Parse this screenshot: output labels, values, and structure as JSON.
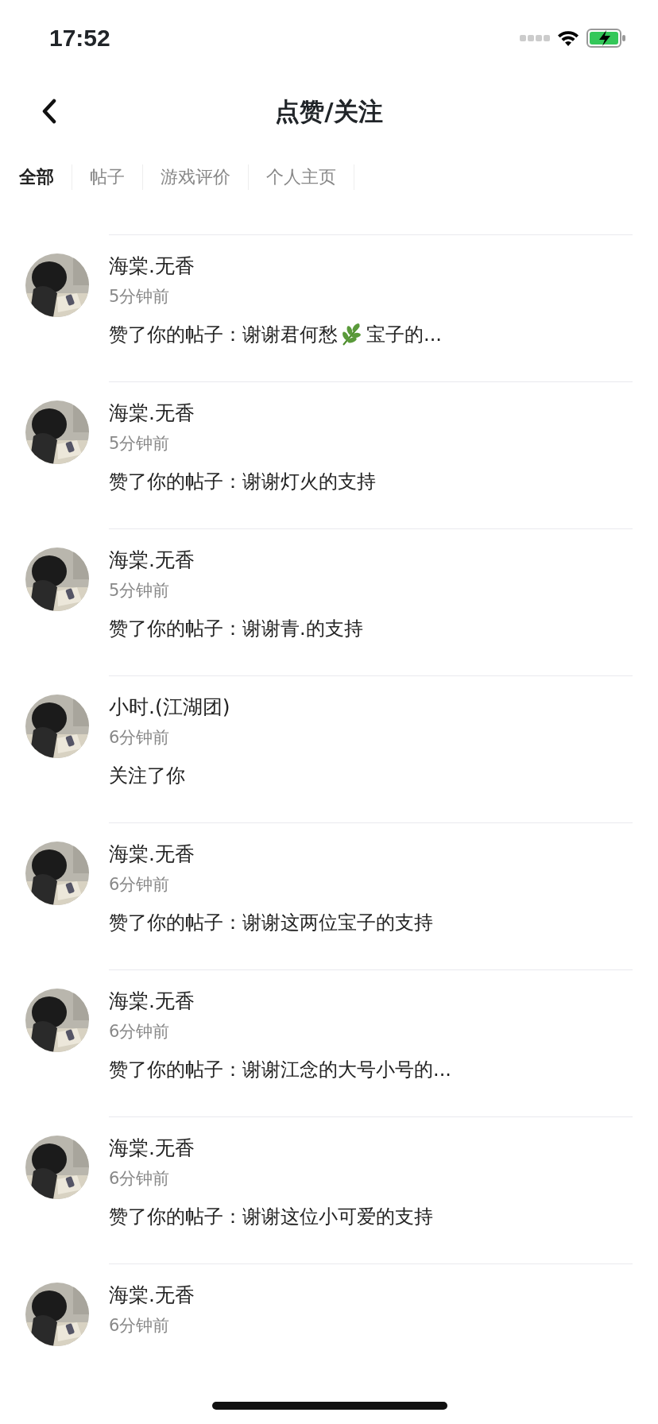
{
  "status_bar": {
    "time": "17:52"
  },
  "nav": {
    "title": "点赞/关注"
  },
  "tabs": [
    {
      "label": "全部",
      "selected": true
    },
    {
      "label": "帖子",
      "selected": false
    },
    {
      "label": "游戏评价",
      "selected": false
    },
    {
      "label": "个人主页",
      "selected": false
    }
  ],
  "notifications": [
    {
      "name": "海棠.无香",
      "time": "5分钟前",
      "content": [
        "赞了你的帖子：谢谢君何愁",
        "宝子的..."
      ]
    },
    {
      "name": "海棠.无香",
      "time": "5分钟前",
      "content": [
        "赞了你的帖子：谢谢灯火的支持"
      ]
    },
    {
      "name": "海棠.无香",
      "time": "5分钟前",
      "content": [
        "赞了你的帖子：谢谢青.的支持"
      ]
    },
    {
      "name": "小时.(江湖团)",
      "time": "6分钟前",
      "content": [
        "关注了你"
      ]
    },
    {
      "name": "海棠.无香",
      "time": "6分钟前",
      "content": [
        "赞了你的帖子：谢谢这两位宝子的支持"
      ]
    },
    {
      "name": "海棠.无香",
      "time": "6分钟前",
      "content": [
        "赞了你的帖子：谢谢江念的大号小号的..."
      ]
    },
    {
      "name": "海棠.无香",
      "time": "6分钟前",
      "content": [
        "赞了你的帖子：谢谢这位小可爱的支持"
      ]
    },
    {
      "name": "海棠.无香",
      "time": "6分钟前"
    }
  ]
}
